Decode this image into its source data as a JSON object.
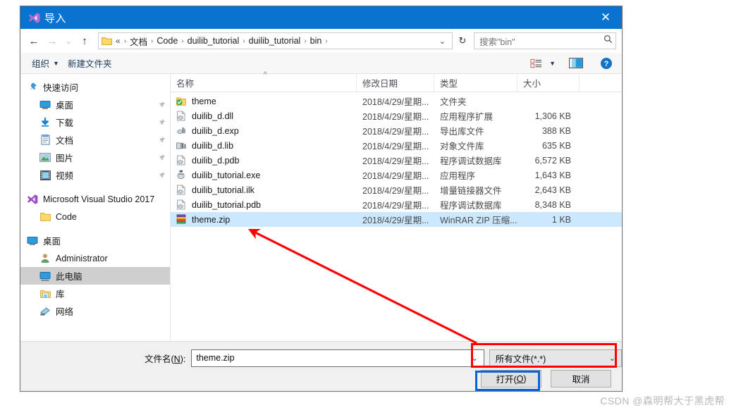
{
  "dialog": {
    "title": "导入",
    "title_icon": "visual-studio-icon",
    "close_label": "✕"
  },
  "nav": {
    "back": "←",
    "forward": "→",
    "recent": "⌄",
    "up": "↑",
    "refresh": "↻",
    "breadcrumb_prefix": "«",
    "breadcrumbs": [
      "文档",
      "Code",
      "duilib_tutorial",
      "duilib_tutorial",
      "bin"
    ],
    "address_caret": "⌄"
  },
  "search": {
    "placeholder": "搜索\"bin\"",
    "icon": "search-icon"
  },
  "toolbar": {
    "organize_label": "组织",
    "new_folder_label": "新建文件夹",
    "caret": "▼",
    "view_icon": "view-options-icon",
    "view_caret": "▼",
    "preview_icon": "preview-pane-icon",
    "help_icon": "help-icon",
    "help_glyph": "?"
  },
  "sidebar": {
    "groups": [
      {
        "header": {
          "label": "快速访问",
          "icon": "pin-star-icon"
        },
        "items": [
          {
            "label": "桌面",
            "icon": "desktop-icon",
            "pinned": true
          },
          {
            "label": "下载",
            "icon": "downloads-icon",
            "pinned": true
          },
          {
            "label": "文档",
            "icon": "documents-icon",
            "pinned": true
          },
          {
            "label": "图片",
            "icon": "pictures-icon",
            "pinned": true
          },
          {
            "label": "视频",
            "icon": "videos-icon",
            "pinned": true
          }
        ]
      },
      {
        "header": {
          "label": "Microsoft Visual Studio 2017",
          "icon": "visual-studio-icon"
        },
        "items": [
          {
            "label": "Code",
            "icon": "folder-icon",
            "pinned": false
          }
        ]
      },
      {
        "header": {
          "label": "桌面",
          "icon": "desktop-icon"
        },
        "items": [
          {
            "label": "Administrator",
            "icon": "user-icon",
            "pinned": false
          },
          {
            "label": "此电脑",
            "icon": "this-pc-icon",
            "pinned": false,
            "selected": true
          },
          {
            "label": "库",
            "icon": "library-icon",
            "pinned": false
          },
          {
            "label": "网络",
            "icon": "network-icon",
            "pinned": false
          }
        ]
      }
    ]
  },
  "filelist": {
    "columns": [
      {
        "label": "名称",
        "sorted": true
      },
      {
        "label": "修改日期",
        "sorted": false
      },
      {
        "label": "类型",
        "sorted": false
      },
      {
        "label": "大小",
        "sorted": false
      }
    ],
    "rows": [
      {
        "name": "theme",
        "icon": "folder-check-icon",
        "date": "2018/4/29/星期...",
        "type": "文件夹",
        "size": ""
      },
      {
        "name": "duilib_d.dll",
        "icon": "dll-file-icon",
        "date": "2018/4/29/星期...",
        "type": "应用程序扩展",
        "size": "1,306 KB"
      },
      {
        "name": "duilib_d.exp",
        "icon": "exp-file-icon",
        "date": "2018/4/29/星期...",
        "type": "导出库文件",
        "size": "388 KB"
      },
      {
        "name": "duilib_d.lib",
        "icon": "lib-file-icon",
        "date": "2018/4/29/星期...",
        "type": "对象文件库",
        "size": "635 KB"
      },
      {
        "name": "duilib_d.pdb",
        "icon": "pdb-file-icon",
        "date": "2018/4/29/星期...",
        "type": "程序调试数据库",
        "size": "6,572 KB"
      },
      {
        "name": "duilib_tutorial.exe",
        "icon": "exe-file-icon",
        "date": "2018/4/29/星期...",
        "type": "应用程序",
        "size": "1,643 KB"
      },
      {
        "name": "duilib_tutorial.ilk",
        "icon": "ilk-file-icon",
        "date": "2018/4/29/星期...",
        "type": "增量链接器文件",
        "size": "2,643 KB"
      },
      {
        "name": "duilib_tutorial.pdb",
        "icon": "pdb-file-icon",
        "date": "2018/4/29/星期...",
        "type": "程序调试数据库",
        "size": "8,348 KB"
      },
      {
        "name": "theme.zip",
        "icon": "zip-file-icon",
        "date": "2018/4/29/星期...",
        "type": "WinRAR ZIP 压缩...",
        "size": "1 KB",
        "selected": true
      }
    ]
  },
  "footer": {
    "filename_label_pre": "文件名(",
    "filename_label_key": "N",
    "filename_label_post": "):",
    "filename_value": "theme.zip",
    "filename_caret": "⌄",
    "filter_value": "所有文件(*.*)",
    "filter_caret": "⌄",
    "open_label_pre": "打开(",
    "open_label_key": "O",
    "open_label_post": ")",
    "cancel_label": "取消"
  },
  "annotations": {
    "filter_highlight_color": "#ff0000",
    "open_highlight_color": "#0a63d6",
    "arrow_color": "#ff0000"
  },
  "watermark": "CSDN @森明帮大于黑虎帮"
}
